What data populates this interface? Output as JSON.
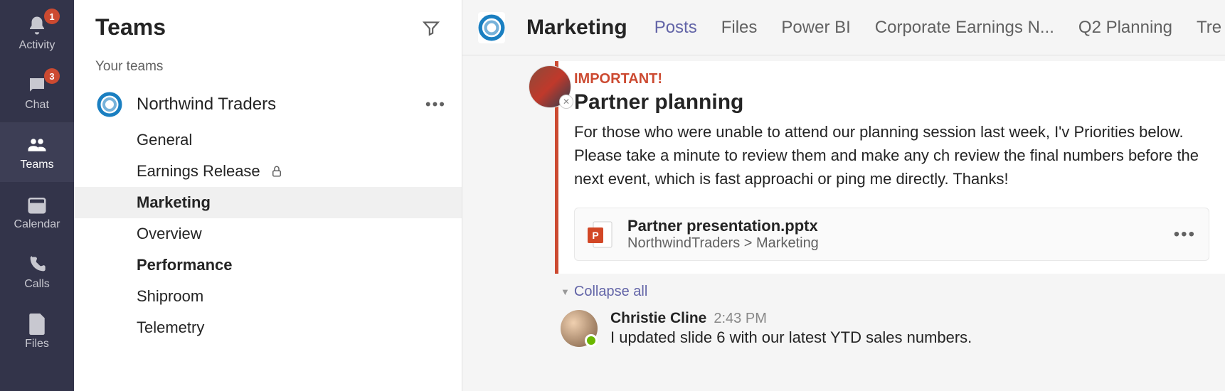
{
  "rail": [
    {
      "id": "activity",
      "label": "Activity",
      "badge": "1",
      "icon": "bell"
    },
    {
      "id": "chat",
      "label": "Chat",
      "badge": "3",
      "icon": "chat"
    },
    {
      "id": "teams",
      "label": "Teams",
      "icon": "people",
      "active": true
    },
    {
      "id": "calendar",
      "label": "Calendar",
      "icon": "calendar"
    },
    {
      "id": "calls",
      "label": "Calls",
      "icon": "phone"
    },
    {
      "id": "files",
      "label": "Files",
      "icon": "file"
    }
  ],
  "sidebar": {
    "title": "Teams",
    "section": "Your teams",
    "team": {
      "name": "Northwind Traders"
    },
    "channels": [
      {
        "name": "General"
      },
      {
        "name": "Earnings Release",
        "locked": true
      },
      {
        "name": "Marketing",
        "selected": true
      },
      {
        "name": "Overview"
      },
      {
        "name": "Performance",
        "bold": true
      },
      {
        "name": "Shiproom"
      },
      {
        "name": "Telemetry"
      }
    ]
  },
  "header": {
    "channel": "Marketing",
    "tabs": [
      {
        "label": "Posts",
        "active": true
      },
      {
        "label": "Files"
      },
      {
        "label": "Power BI"
      },
      {
        "label": "Corporate Earnings N..."
      },
      {
        "label": "Q2 Planning"
      },
      {
        "label": "Tre"
      }
    ]
  },
  "post": {
    "flag": "IMPORTANT!",
    "title": "Partner planning",
    "body": "For those who were unable to attend our planning session last week, I'v Priorities below.  Please take a minute to review them and make any ch review the final numbers before the next event, which is fast approachi or ping me directly. Thanks!",
    "attachment": {
      "name": "Partner presentation.pptx",
      "location": "NorthwindTraders > Marketing"
    },
    "collapse": "Collapse all"
  },
  "reply": {
    "author": "Christie Cline",
    "time": "2:43 PM",
    "text": "I updated slide 6 with our latest YTD sales numbers."
  }
}
